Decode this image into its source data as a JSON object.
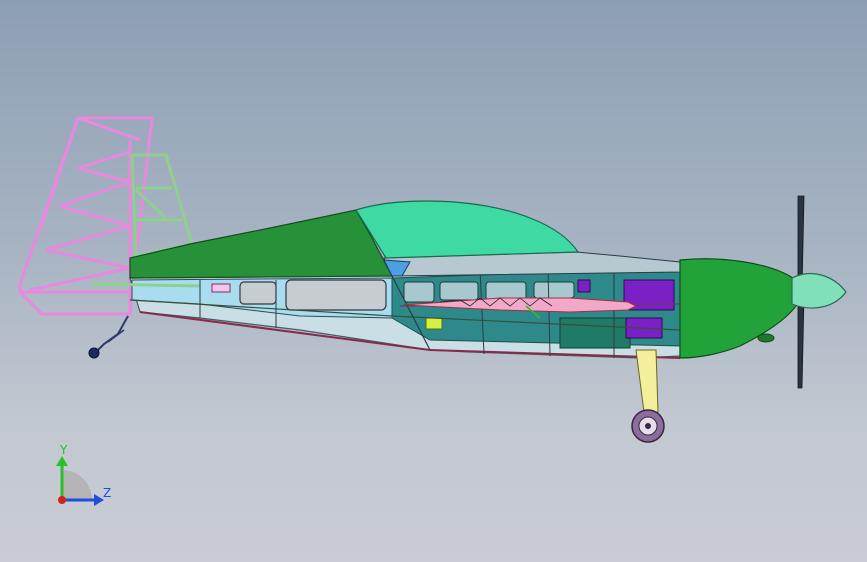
{
  "triad": {
    "y_label": "Y",
    "z_label": "Z"
  },
  "colors": {
    "fuselage_top": "#27913a",
    "canopy": "#3fd9a4",
    "cowling": "#22a33a",
    "spinner": "#7fe0b9",
    "tail_frame": "#e88ae0",
    "fin_frame": "#8fd18f",
    "structure_panel": "#9fd6e6",
    "battery": "#7a20c4",
    "gear_leg": "#f3ef9c",
    "wheel": "#8a6f9c",
    "axis_y": "#2bbf2b",
    "axis_z": "#1f4fd6",
    "axis_origin": "#d21f1f"
  }
}
